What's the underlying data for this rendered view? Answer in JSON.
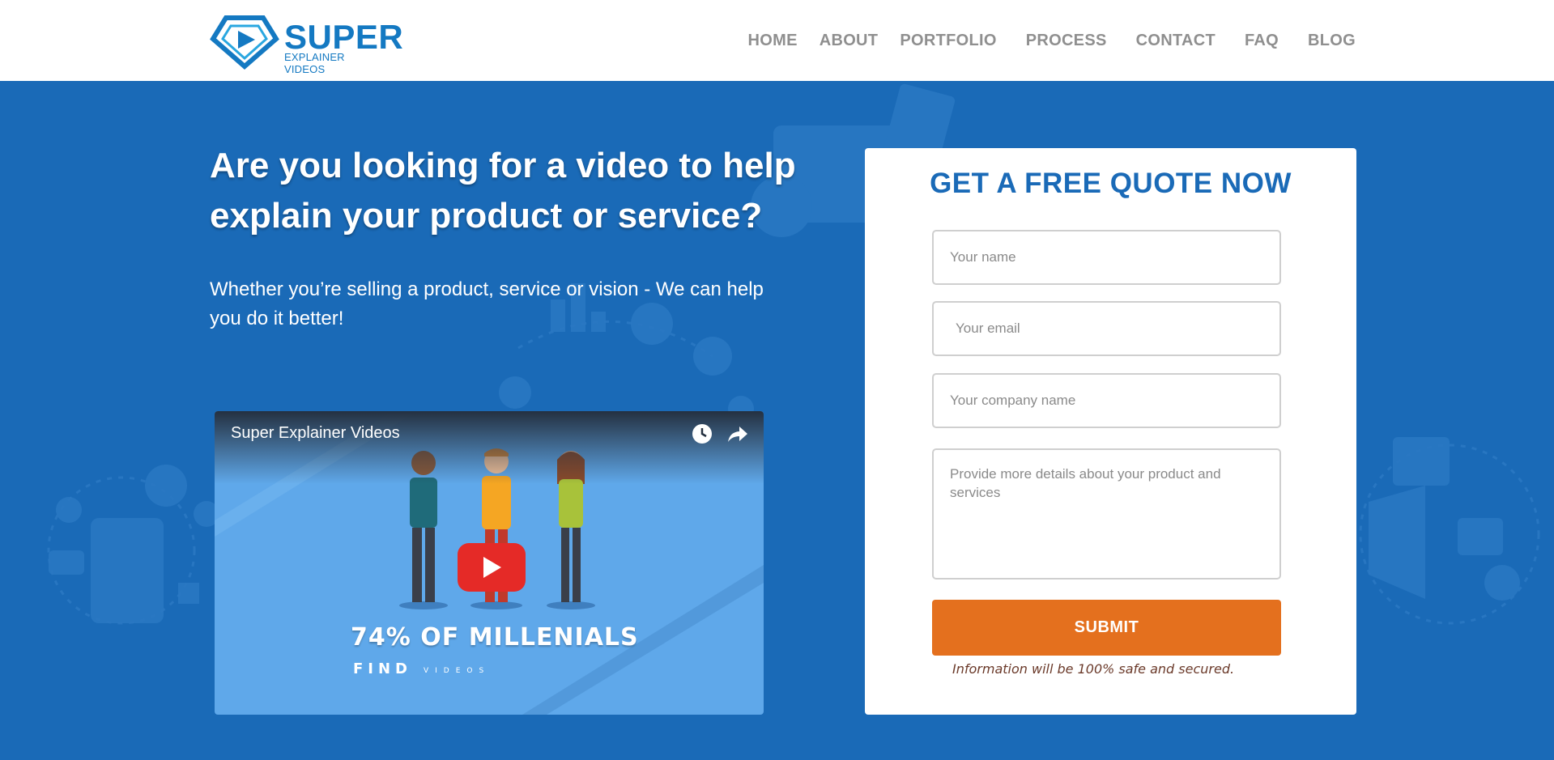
{
  "brand": {
    "name": "SUPER",
    "tagline": "EXPLAINER VIDEOS",
    "colors": {
      "primary": "#1a6ab7",
      "accent": "#e4701e",
      "logo": "#1479c2"
    }
  },
  "nav": {
    "items": [
      {
        "label": "HOME"
      },
      {
        "label": "ABOUT"
      },
      {
        "label": "PORTFOLIO"
      },
      {
        "label": "PROCESS"
      },
      {
        "label": "CONTACT"
      },
      {
        "label": "FAQ"
      },
      {
        "label": "BLOG"
      }
    ]
  },
  "hero": {
    "title": "Are you looking for a video to help explain your product or service?",
    "subtitle": "Whether you’re selling a product, service or vision - We can help you do it better!"
  },
  "video": {
    "title": "Super Explainer Videos",
    "caption_big": "74% OF MILLENIALS",
    "caption_small": "FIND",
    "caption_tiny": "VIDEOS",
    "icons": {
      "watch_later": "clock-icon",
      "share": "share-icon",
      "play": "play-icon"
    }
  },
  "form": {
    "title": "GET A FREE QUOTE NOW",
    "name_placeholder": "Your name",
    "email_placeholder": "Your email",
    "company_placeholder": "Your company name",
    "details_placeholder": "Provide more details about your product and services",
    "submit_label": "SUBMIT",
    "safe_note": "Information will be 100% safe and secured."
  }
}
